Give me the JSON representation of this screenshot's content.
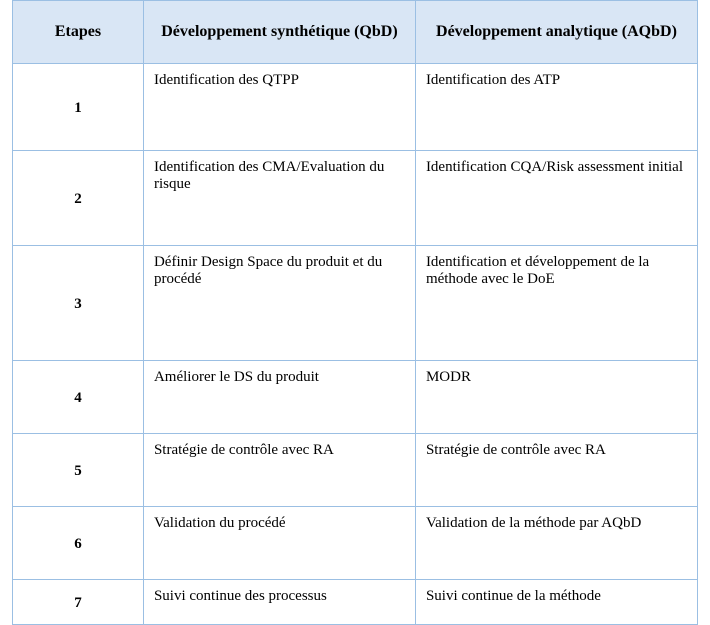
{
  "headers": {
    "col1": "Etapes",
    "col2": "Développement synthétique (QbD)",
    "col3": "Développement analytique (AQbD)"
  },
  "rows": [
    {
      "step": "1",
      "qbd": "Identification des QTPP",
      "aqbd": "Identification des ATP"
    },
    {
      "step": "2",
      "qbd": "Identification des CMA/Evaluation du risque",
      "aqbd": "Identification CQA/Risk assessment initial"
    },
    {
      "step": "3",
      "qbd": "Définir Design Space du produit et du procédé",
      "aqbd": "Identification et développement  de la méthode avec le DoE"
    },
    {
      "step": "4",
      "qbd": "Améliorer le DS du produit",
      "aqbd": "MODR"
    },
    {
      "step": "5",
      "qbd": "Stratégie de contrôle avec RA",
      "aqbd": "Stratégie de contrôle avec RA"
    },
    {
      "step": "6",
      "qbd": "Validation du procédé",
      "aqbd": "Validation de la méthode par AQbD"
    },
    {
      "step": "7",
      "qbd": "Suivi continue des processus",
      "aqbd": "Suivi continue de la méthode"
    }
  ]
}
